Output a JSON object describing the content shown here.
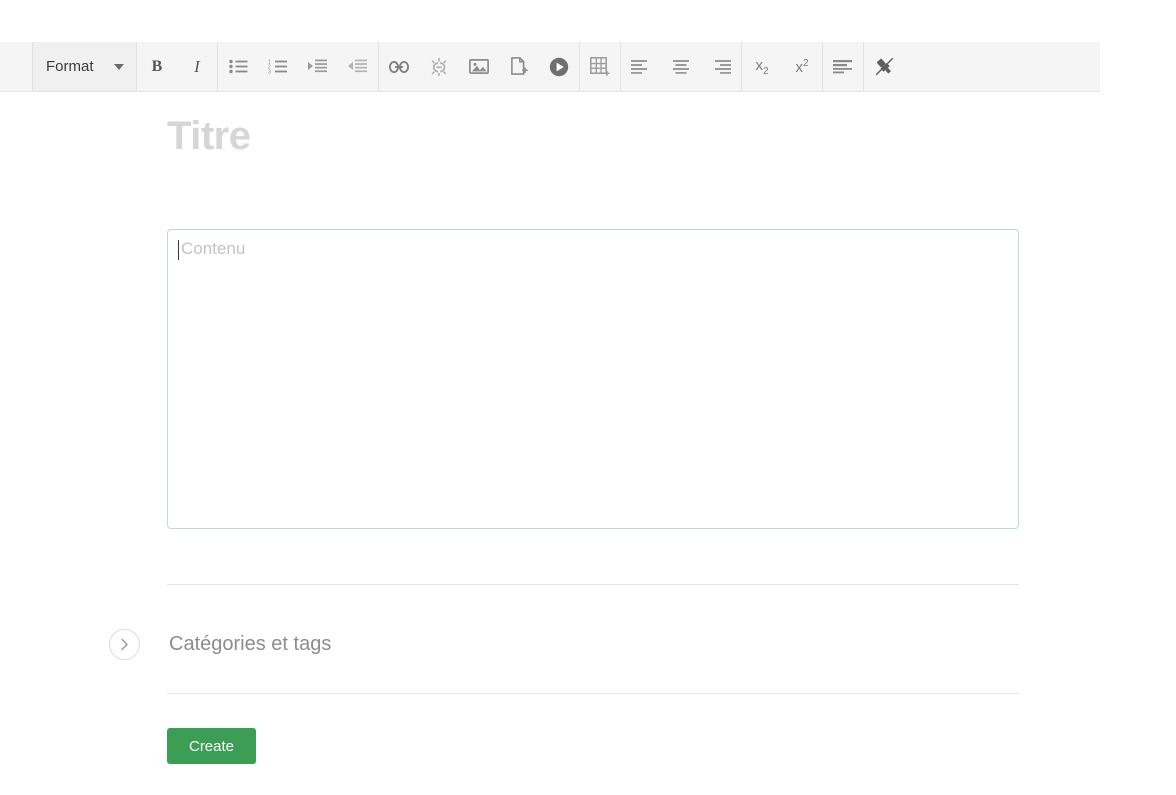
{
  "toolbar": {
    "format_dropdown": {
      "label": "Format",
      "icon": "chevron-down-icon"
    },
    "groups": [
      {
        "name": "text-style-group",
        "buttons": [
          {
            "name": "bold-button",
            "icon": "bold-icon",
            "glyph": "B"
          },
          {
            "name": "italic-button",
            "icon": "italic-icon",
            "glyph": "I"
          }
        ]
      },
      {
        "name": "list-group",
        "buttons": [
          {
            "name": "bullet-list-button",
            "icon": "bullet-list-icon"
          },
          {
            "name": "numbered-list-button",
            "icon": "numbered-list-icon"
          },
          {
            "name": "indent-button",
            "icon": "indent-increase-icon"
          },
          {
            "name": "outdent-button",
            "icon": "indent-decrease-icon"
          }
        ]
      },
      {
        "name": "insert-group",
        "buttons": [
          {
            "name": "link-button",
            "icon": "link-icon"
          },
          {
            "name": "unlink-button",
            "icon": "unlink-icon"
          },
          {
            "name": "insert-image-button",
            "icon": "image-icon"
          },
          {
            "name": "insert-file-button",
            "icon": "file-add-icon"
          },
          {
            "name": "insert-video-button",
            "icon": "video-play-icon"
          }
        ]
      },
      {
        "name": "table-group",
        "buttons": [
          {
            "name": "insert-table-button",
            "icon": "table-add-icon"
          }
        ]
      },
      {
        "name": "align-group",
        "buttons": [
          {
            "name": "align-left-button",
            "icon": "align-left-icon"
          },
          {
            "name": "align-center-button",
            "icon": "align-center-icon"
          },
          {
            "name": "align-right-button",
            "icon": "align-right-icon"
          }
        ]
      },
      {
        "name": "script-group",
        "buttons": [
          {
            "name": "subscript-button",
            "icon": "subscript-icon",
            "glyph": "x2"
          },
          {
            "name": "superscript-button",
            "icon": "superscript-icon",
            "glyph": "x2"
          }
        ]
      },
      {
        "name": "justify-group",
        "buttons": [
          {
            "name": "align-justify-button",
            "icon": "align-justify-icon"
          }
        ]
      },
      {
        "name": "clear-format-group",
        "buttons": [
          {
            "name": "remove-format-button",
            "icon": "remove-format-brush-icon"
          }
        ]
      }
    ]
  },
  "editor": {
    "title_placeholder": "Titre",
    "title_value": "",
    "content_placeholder": "Contenu",
    "content_value": ""
  },
  "categories": {
    "label": "Catégories et tags",
    "toggle_icon": "chevron-right-icon",
    "expanded": false
  },
  "actions": {
    "create_label": "Create"
  },
  "colors": {
    "accent_green": "#3c9e54",
    "toolbar_bg": "#f5f5f5",
    "focus_border": "#bfd6ea",
    "placeholder_gray": "#c3c3c3",
    "title_placeholder_gray": "#d6d6d6"
  }
}
